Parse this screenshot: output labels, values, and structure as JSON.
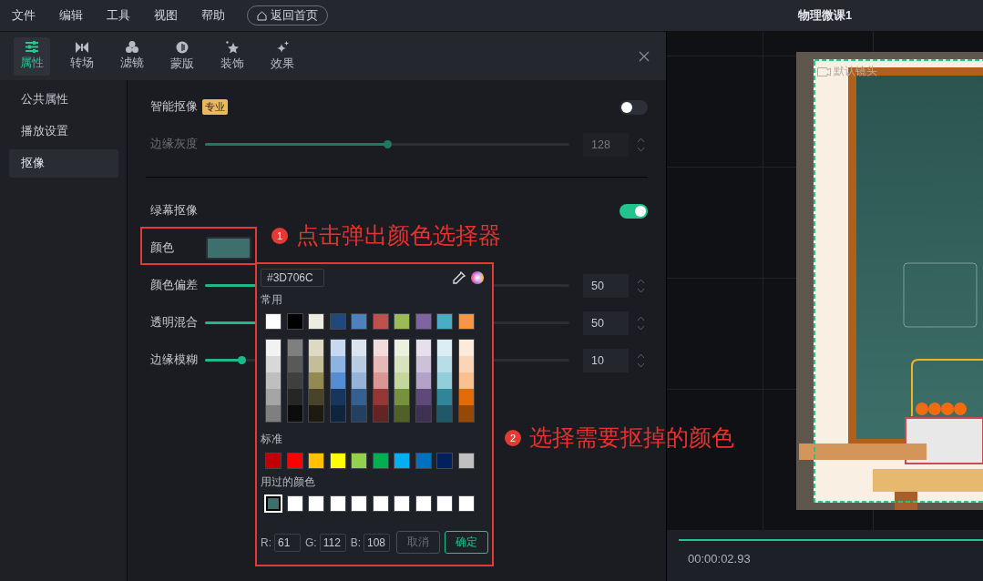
{
  "menu": [
    "文件",
    "编辑",
    "工具",
    "视图",
    "帮助"
  ],
  "home_button": "返回首页",
  "project_title": "物理微课1",
  "tabs": [
    {
      "label": "属性",
      "selected": true
    },
    {
      "label": "转场",
      "selected": false
    },
    {
      "label": "滤镜",
      "selected": false
    },
    {
      "label": "蒙版",
      "selected": false
    },
    {
      "label": "装饰",
      "selected": false
    },
    {
      "label": "效果",
      "selected": false
    }
  ],
  "sidebar": [
    {
      "label": "公共属性",
      "selected": false
    },
    {
      "label": "播放设置",
      "selected": false
    },
    {
      "label": "抠像",
      "selected": true
    }
  ],
  "smart_keying": {
    "label": "智能抠像",
    "badge": "专业",
    "on": false
  },
  "edge_gray": {
    "label": "边缘灰度",
    "level": 0.5,
    "value": "128",
    "disabled": true
  },
  "green_screen": {
    "label": "绿幕抠像",
    "on": true
  },
  "key_color": {
    "label": "颜色",
    "color": "#3d706c"
  },
  "sliders": [
    {
      "label": "颜色偏差",
      "level": 0.5,
      "value": "50"
    },
    {
      "label": "透明混合",
      "level": 0.5,
      "value": "50"
    },
    {
      "label": "边缘模糊",
      "level": 0.1,
      "value": "10"
    }
  ],
  "picker": {
    "hex": "#3D706C",
    "common_label": "常用",
    "common": [
      {
        "color": "#ffffff"
      },
      {
        "color": "#000000"
      },
      {
        "color": "#eeece1"
      },
      {
        "color": "#1f497d"
      },
      {
        "color": "#4f81bd"
      },
      {
        "color": "#c0504d"
      },
      {
        "color": "#9bbb59"
      },
      {
        "color": "#8064a2"
      },
      {
        "color": "#4bacc6"
      },
      {
        "color": "#f79646"
      }
    ],
    "shade_columns": [
      {
        "shades": [
          {
            "color": "#f2f2f2"
          },
          {
            "color": "#d8d8d8"
          },
          {
            "color": "#bfbfbf"
          },
          {
            "color": "#a5a5a5"
          },
          {
            "color": "#7f7f7f"
          }
        ]
      },
      {
        "shades": [
          {
            "color": "#7f7f7f"
          },
          {
            "color": "#595959"
          },
          {
            "color": "#3f3f3f"
          },
          {
            "color": "#262626"
          },
          {
            "color": "#0c0c0c"
          }
        ]
      },
      {
        "shades": [
          {
            "color": "#ddd9c3"
          },
          {
            "color": "#c4bd97"
          },
          {
            "color": "#938953"
          },
          {
            "color": "#494429"
          },
          {
            "color": "#1d1b10"
          }
        ]
      },
      {
        "shades": [
          {
            "color": "#c6d9f0"
          },
          {
            "color": "#8db3e2"
          },
          {
            "color": "#548dd4"
          },
          {
            "color": "#17365d"
          },
          {
            "color": "#0f243e"
          }
        ]
      },
      {
        "shades": [
          {
            "color": "#dbe5f1"
          },
          {
            "color": "#b8cce4"
          },
          {
            "color": "#95b3d7"
          },
          {
            "color": "#366092"
          },
          {
            "color": "#244061"
          }
        ]
      },
      {
        "shades": [
          {
            "color": "#f2dcdb"
          },
          {
            "color": "#e5b9b7"
          },
          {
            "color": "#d99694"
          },
          {
            "color": "#953734"
          },
          {
            "color": "#632423"
          }
        ]
      },
      {
        "shades": [
          {
            "color": "#ebf1dd"
          },
          {
            "color": "#d7e3bc"
          },
          {
            "color": "#c3d69b"
          },
          {
            "color": "#76923c"
          },
          {
            "color": "#4f6128"
          }
        ]
      },
      {
        "shades": [
          {
            "color": "#e5e0ec"
          },
          {
            "color": "#ccc1d9"
          },
          {
            "color": "#b2a2c7"
          },
          {
            "color": "#5f497a"
          },
          {
            "color": "#3f3151"
          }
        ]
      },
      {
        "shades": [
          {
            "color": "#dbeef3"
          },
          {
            "color": "#b7dde8"
          },
          {
            "color": "#92cddc"
          },
          {
            "color": "#31859b"
          },
          {
            "color": "#205867"
          }
        ]
      },
      {
        "shades": [
          {
            "color": "#fdeada"
          },
          {
            "color": "#fbd5b5"
          },
          {
            "color": "#fac08f"
          },
          {
            "color": "#e36c09"
          },
          {
            "color": "#974806"
          }
        ]
      }
    ],
    "standard_label": "标准",
    "standard": [
      {
        "color": "#c00000"
      },
      {
        "color": "#ff0000"
      },
      {
        "color": "#ffc000"
      },
      {
        "color": "#ffff00"
      },
      {
        "color": "#92d050"
      },
      {
        "color": "#00b050"
      },
      {
        "color": "#00b0f0"
      },
      {
        "color": "#0070c0"
      },
      {
        "color": "#002060"
      },
      {
        "color": "#c0c0c0"
      }
    ],
    "used_label": "用过的颜色",
    "used": [
      {
        "color": "#3d706c",
        "selected": true
      },
      {
        "color": "#ffffff",
        "selected": false
      },
      {
        "color": "#ffffff",
        "selected": false
      },
      {
        "color": "#ffffff",
        "selected": false
      },
      {
        "color": "#ffffff",
        "selected": false
      },
      {
        "color": "#ffffff",
        "selected": false
      },
      {
        "color": "#ffffff",
        "selected": false
      },
      {
        "color": "#ffffff",
        "selected": false
      },
      {
        "color": "#ffffff",
        "selected": false
      },
      {
        "color": "#ffffff",
        "selected": false
      }
    ],
    "r_label": "R:",
    "r": "61",
    "g_label": "G:",
    "g": "112",
    "b_label": "B:",
    "b": "108",
    "cancel": "取消",
    "ok": "确定"
  },
  "preview": {
    "camera_label": "默认镜头",
    "time": "00:00:02.93"
  },
  "annotations": [
    {
      "number": "1",
      "text": "点击弹出颜色选择器"
    },
    {
      "number": "2",
      "text": "选择需要抠掉的颜色"
    }
  ]
}
